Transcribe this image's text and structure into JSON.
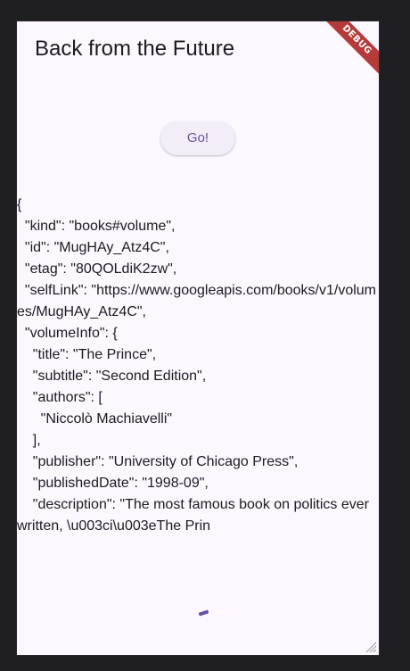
{
  "appbar": {
    "title": "Back from the Future",
    "debug_banner": "DEBUG"
  },
  "actions": {
    "go_label": "Go!"
  },
  "response": {
    "json_text": "{\n  \"kind\": \"books#volume\",\n  \"id\": \"MugHAy_Atz4C\",\n  \"etag\": \"80QOLdiK2zw\",\n  \"selfLink\": \"https://www.googleapis.com/books/v1/volumes/MugHAy_Atz4C\",\n  \"volumeInfo\": {\n    \"title\": \"The Prince\",\n    \"subtitle\": \"Second Edition\",\n    \"authors\": [\n      \"Niccolò Machiavelli\"\n    ],\n    \"publisher\": \"University of Chicago Press\",\n    \"publishedDate\": \"1998-09\",\n    \"description\": \"The most famous book on politics ever written, \\u003ci\\u003eThe Prin"
  },
  "colors": {
    "surface": "#fdf7ff",
    "primary": "#6750a4",
    "button_bg": "#f3edf7",
    "debug_ribbon": "#b53a3a",
    "window_bg": "#1f1f22"
  },
  "icons": {
    "progress": "progress-indicator-icon",
    "resize": "resize-grip-icon"
  }
}
